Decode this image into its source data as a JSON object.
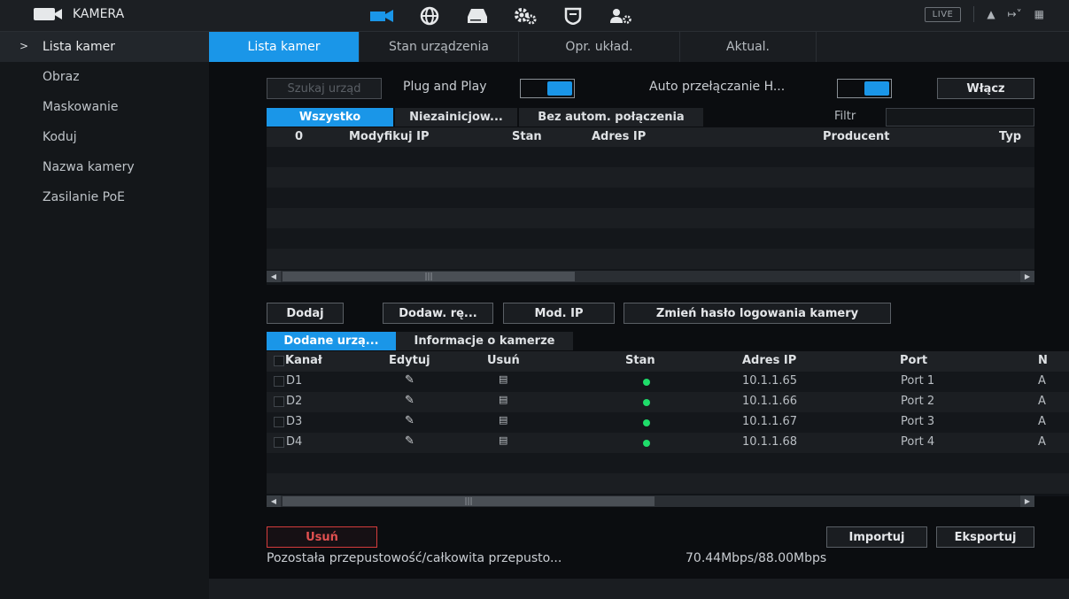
{
  "topbar": {
    "brand": "KAMERA",
    "icons": [
      "camera-icon",
      "network-icon",
      "storage-icon",
      "system-settings-icon",
      "security-icon",
      "account-icon"
    ],
    "live_label": "LIVE",
    "right_icons": [
      "user-icon",
      "logout-icon",
      "grid-icon"
    ]
  },
  "sidebar": {
    "items": [
      {
        "label": "Lista kamer",
        "active": true
      },
      {
        "label": "Obraz",
        "active": false
      },
      {
        "label": "Maskowanie",
        "active": false
      },
      {
        "label": "Koduj",
        "active": false
      },
      {
        "label": "Nazwa kamery",
        "active": false
      },
      {
        "label": "Zasilanie PoE",
        "active": false
      }
    ]
  },
  "tabs": [
    "Lista kamer",
    "Stan urządzenia",
    "Opr. układ.",
    "Aktual."
  ],
  "search": {
    "search_button": "Szukaj urząd",
    "plug_and_play_label": "Plug and Play",
    "auto_switch_label": "Auto przełączanie H...",
    "enable_button": "Włącz"
  },
  "filter_tabs": [
    "Wszystko",
    "Niezainicjow...",
    "Bez autom. połączenia"
  ],
  "filter_label": "Filtr",
  "found_table": {
    "columns": [
      "0",
      "Modyfikuj IP",
      "Stan",
      "Adres IP",
      "Producent",
      "Typ"
    ]
  },
  "actions": {
    "add": "Dodaj",
    "manual_add": "Dodaw. rę...",
    "modify_ip": "Mod. IP",
    "change_password": "Zmień hasło logowania kamery"
  },
  "added_tabs": [
    "Dodane urzą...",
    "Informacje o kamerze"
  ],
  "added_table": {
    "columns": [
      "Kanał",
      "Edytuj",
      "Usuń",
      "Stan",
      "Adres IP",
      "Port",
      "N"
    ],
    "rows": [
      {
        "channel": "D1",
        "ip": "10.1.1.65",
        "port": "Port 1",
        "n": "A"
      },
      {
        "channel": "D2",
        "ip": "10.1.1.66",
        "port": "Port 2",
        "n": "A"
      },
      {
        "channel": "D3",
        "ip": "10.1.1.67",
        "port": "Port 3",
        "n": "A"
      },
      {
        "channel": "D4",
        "ip": "10.1.1.68",
        "port": "Port 4",
        "n": "A"
      }
    ]
  },
  "bottom": {
    "delete_button": "Usuń",
    "import_button": "Importuj",
    "export_button": "Eksportuj",
    "bandwidth_label": "Pozostała przepustowość/całkowita przepusto...",
    "bandwidth_value": "70.44Mbps/88.00Mbps"
  },
  "colors": {
    "accent": "#1a96e8",
    "status_online": "#1fdc6a",
    "danger": "#e05050"
  }
}
